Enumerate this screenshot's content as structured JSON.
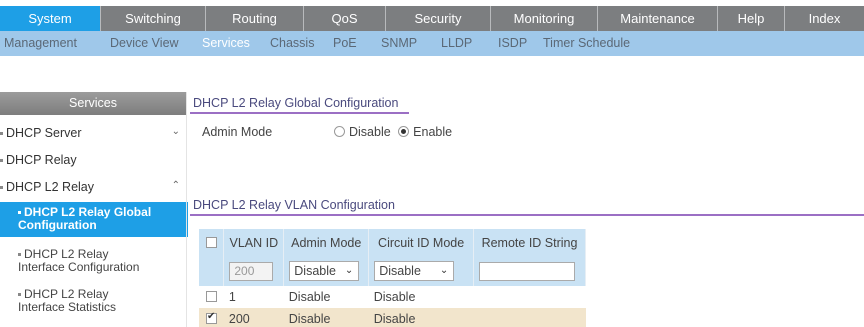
{
  "top_nav": {
    "tabs": [
      {
        "label": "System",
        "active": true
      },
      {
        "label": "Switching"
      },
      {
        "label": "Routing"
      },
      {
        "label": "QoS"
      },
      {
        "label": "Security"
      },
      {
        "label": "Monitoring"
      },
      {
        "label": "Maintenance"
      },
      {
        "label": "Help"
      },
      {
        "label": "Index"
      }
    ]
  },
  "sub_nav": {
    "items": [
      {
        "label": "Management"
      },
      {
        "label": "Device View"
      },
      {
        "label": "Services",
        "active": true
      },
      {
        "label": "Chassis"
      },
      {
        "label": "PoE"
      },
      {
        "label": "SNMP"
      },
      {
        "label": "LLDP"
      },
      {
        "label": "ISDP"
      },
      {
        "label": "Timer Schedule"
      }
    ]
  },
  "sidebar": {
    "header": "Services",
    "items": [
      {
        "label": "DHCP Server",
        "expander": "chevron-down"
      },
      {
        "label": "DHCP Relay"
      },
      {
        "label": "DHCP L2 Relay",
        "expander": "chevron-up"
      }
    ],
    "sub_items": [
      {
        "line1": "DHCP L2 Relay Global",
        "line2": "Configuration",
        "active": true
      },
      {
        "line1": "DHCP L2 Relay",
        "line2": "Interface Configuration"
      },
      {
        "line1": "DHCP L2 Relay",
        "line2": "Interface Statistics"
      }
    ]
  },
  "global_config": {
    "title": "DHCP L2 Relay Global Configuration",
    "admin_mode_label": "Admin Mode",
    "options": [
      "Disable",
      "Enable"
    ],
    "selected": "Enable"
  },
  "vlan_config": {
    "title": "DHCP L2 Relay VLAN Configuration",
    "columns": [
      "VLAN ID",
      "Admin Mode",
      "Circuit ID Mode",
      "Remote ID String"
    ],
    "entry": {
      "vlan_id": "200",
      "admin_mode": "Disable",
      "circuit_id_mode": "Disable",
      "remote_id": ""
    },
    "rows": [
      {
        "checked": false,
        "vlan_id": "1",
        "admin_mode": "Disable",
        "circuit_id_mode": "Disable",
        "remote_id": ""
      },
      {
        "checked": true,
        "vlan_id": "200",
        "admin_mode": "Disable",
        "circuit_id_mode": "Disable",
        "remote_id": ""
      }
    ]
  },
  "colors": {
    "active_tab": "#1e9fe6",
    "nav_bar": "#7c7e80",
    "sub_nav": "#9fc8ea",
    "table_header": "#c9e2f4",
    "selected_row": "#f2e5cc",
    "section_underline": "#9b6fc4"
  }
}
